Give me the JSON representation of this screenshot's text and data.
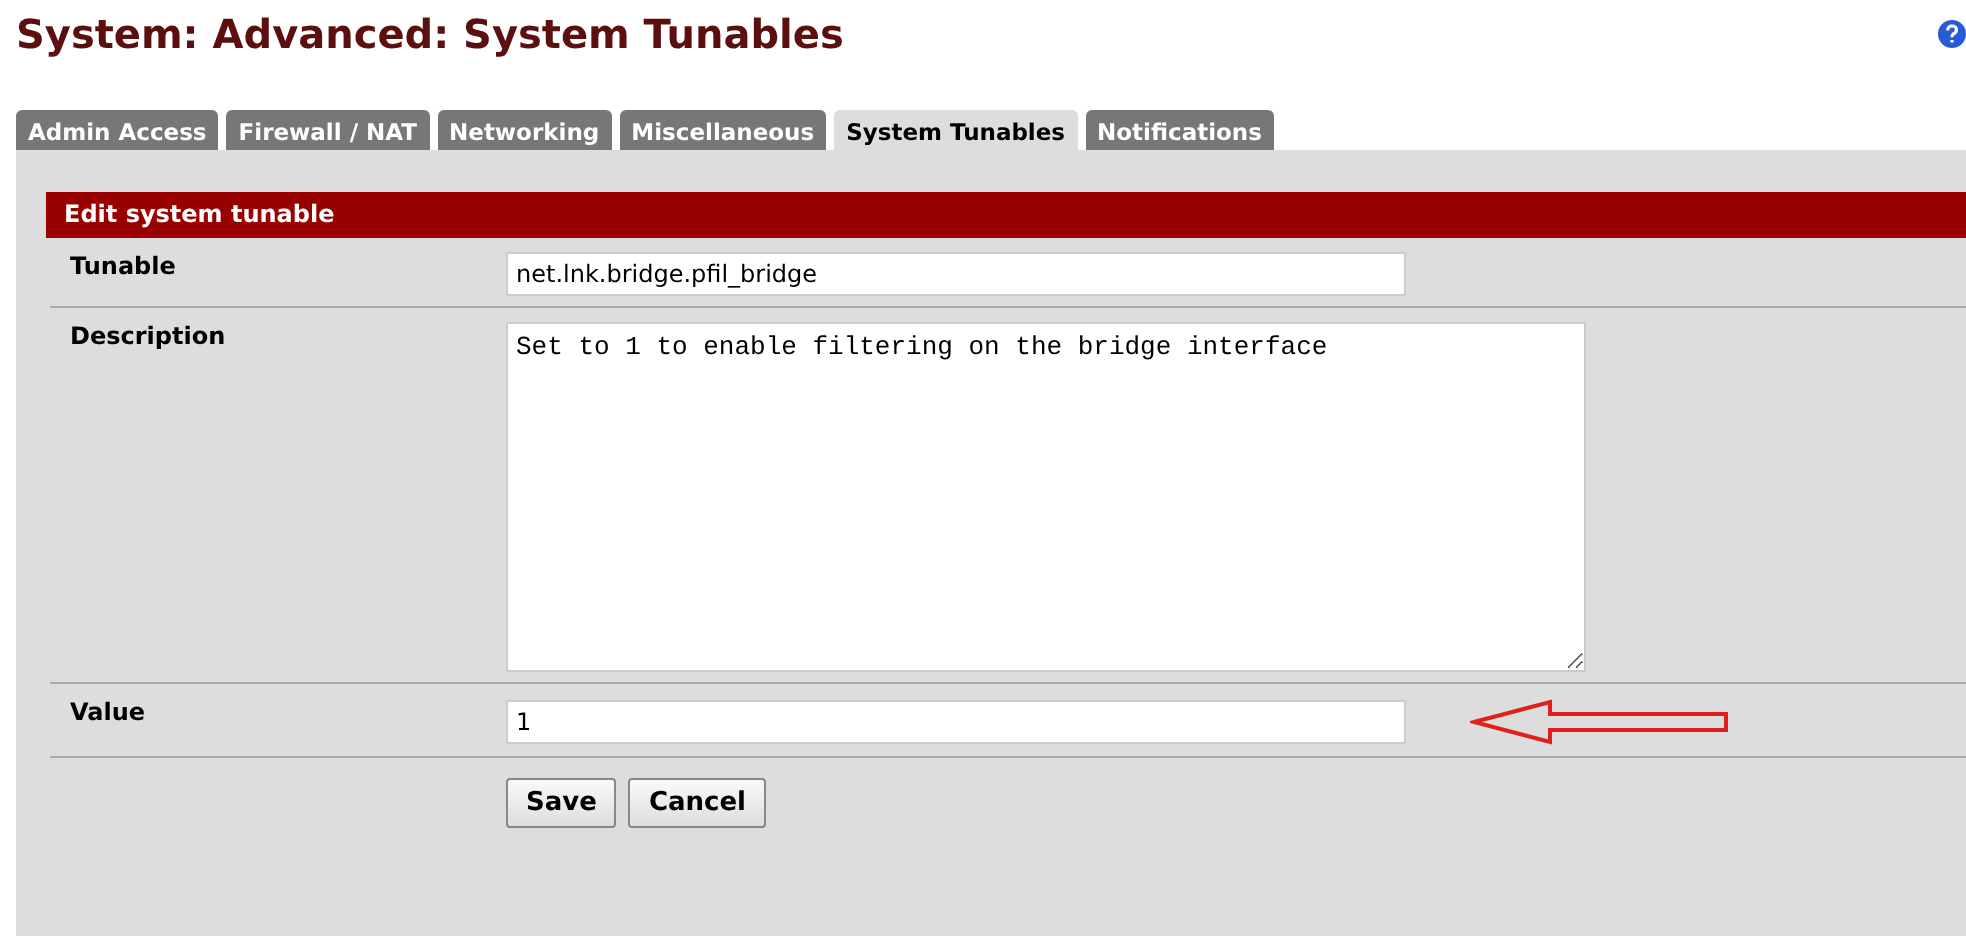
{
  "page": {
    "title": "System: Advanced: System Tunables"
  },
  "tabs": [
    {
      "label": "Admin Access",
      "selected": false
    },
    {
      "label": "Firewall / NAT",
      "selected": false
    },
    {
      "label": "Networking",
      "selected": false
    },
    {
      "label": "Miscellaneous",
      "selected": false
    },
    {
      "label": "System Tunables",
      "selected": true
    },
    {
      "label": "Notifications",
      "selected": false
    }
  ],
  "section": {
    "title": "Edit system tunable"
  },
  "fields": [
    {
      "kind": "text",
      "label": "Tunable",
      "value": "net.lnk.bridge.pfil_bridge"
    },
    {
      "kind": "textarea",
      "label": "Description",
      "value": "Set to 1 to enable filtering on the bridge interface"
    },
    {
      "kind": "text",
      "label": "Value",
      "value": "1",
      "highlighted": true
    }
  ],
  "buttons": [
    "Save",
    "Cancel"
  ]
}
